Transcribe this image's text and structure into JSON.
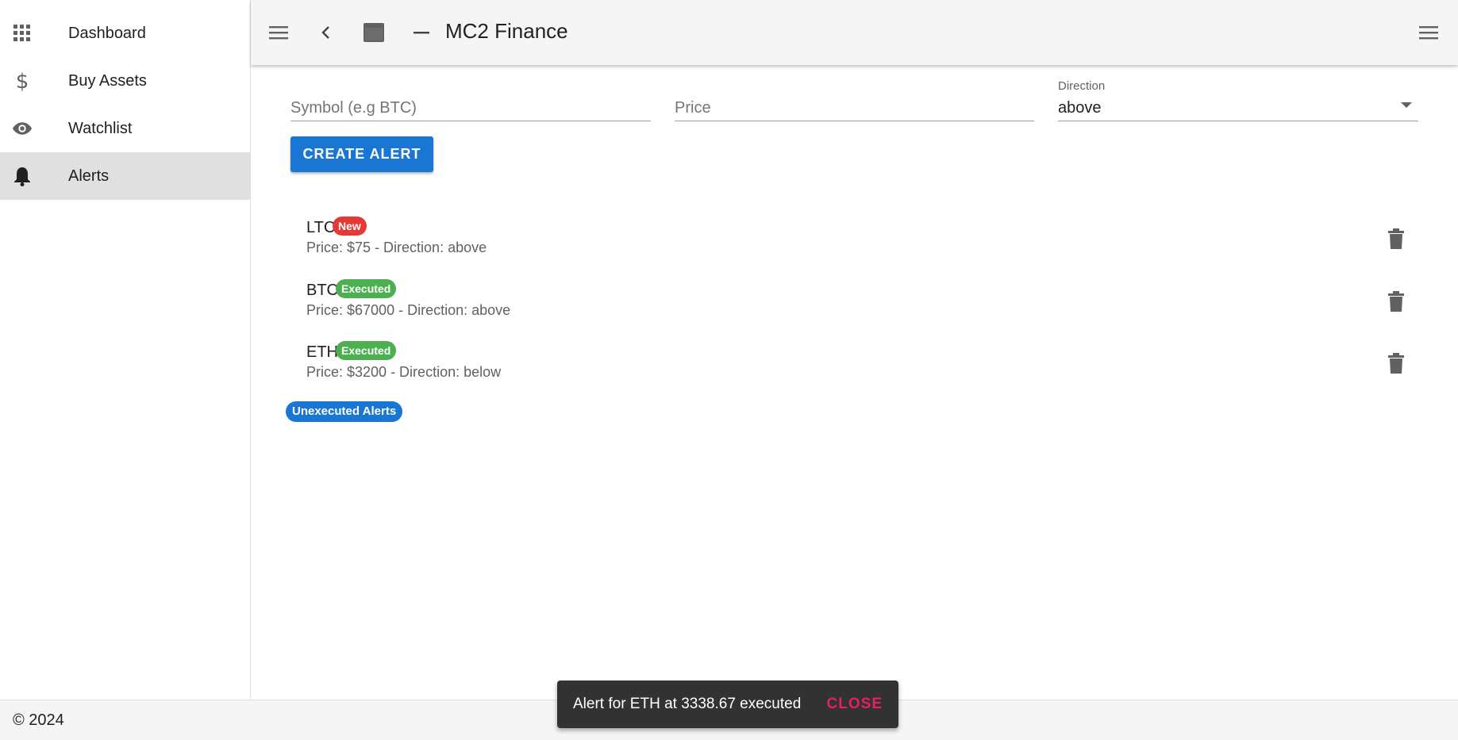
{
  "sidebar": {
    "items": [
      {
        "label": "Dashboard",
        "icon": "grid-icon"
      },
      {
        "label": "Buy Assets",
        "icon": "dollar-icon"
      },
      {
        "label": "Watchlist",
        "icon": "eye-icon"
      },
      {
        "label": "Alerts",
        "icon": "bell-icon",
        "active": true
      }
    ]
  },
  "toolbar": {
    "title": "MC2 Finance",
    "icons": [
      "menu-icon",
      "chevron-left-icon",
      "window-icon",
      "minimize-icon",
      "more-menu-icon"
    ]
  },
  "form": {
    "symbol_placeholder": "Symbol (e.g BTC)",
    "symbol_value": "",
    "price_placeholder": "Price",
    "price_value": "",
    "direction_label": "Direction",
    "direction_value": "above",
    "create_button": "CREATE ALERT"
  },
  "alerts": [
    {
      "symbol": "LTC",
      "badge": "New",
      "badge_color": "#e53935",
      "description": "Price: $75 - Direction: above"
    },
    {
      "symbol": "BTC",
      "badge": "Executed",
      "badge_color": "#4caf50",
      "description": "Price: $67000 - Direction: above"
    },
    {
      "symbol": "ETH",
      "badge": "Executed",
      "badge_color": "#4caf50",
      "description": "Price: $3200 - Direction: below"
    }
  ],
  "unexecuted_chip": "Unexecuted Alerts",
  "footer": {
    "text": "© 2024"
  },
  "snackbar": {
    "message": "Alert for ETH at 3338.67 executed",
    "action": "CLOSE"
  },
  "colors": {
    "primary": "#1976d2",
    "new_badge": "#e53935",
    "executed_badge": "#4caf50",
    "snackbar_action": "#e91e63"
  }
}
